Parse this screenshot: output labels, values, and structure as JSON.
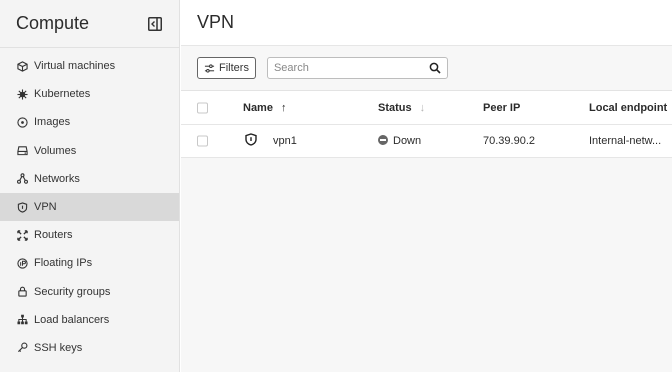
{
  "sidebar": {
    "title": "Compute",
    "collapse_icon": "sidebar-collapse-icon",
    "items": [
      {
        "label": "Virtual machines",
        "icon": "cube-icon",
        "active": false
      },
      {
        "label": "Kubernetes",
        "icon": "helm-icon",
        "active": false
      },
      {
        "label": "Images",
        "icon": "disc-icon",
        "active": false
      },
      {
        "label": "Volumes",
        "icon": "drive-icon",
        "active": false
      },
      {
        "label": "Networks",
        "icon": "network-icon",
        "active": false
      },
      {
        "label": "VPN",
        "icon": "shield-icon",
        "active": true
      },
      {
        "label": "Routers",
        "icon": "router-icon",
        "active": false
      },
      {
        "label": "Floating IPs",
        "icon": "floating-ip-icon",
        "active": false
      },
      {
        "label": "Security groups",
        "icon": "lock-icon",
        "active": false
      },
      {
        "label": "Load balancers",
        "icon": "load-balancer-icon",
        "active": false
      },
      {
        "label": "SSH keys",
        "icon": "key-icon",
        "active": false
      }
    ]
  },
  "header": {
    "title": "VPN"
  },
  "toolbar": {
    "filters_label": "Filters",
    "search_placeholder": "Search",
    "search_value": ""
  },
  "table": {
    "columns": [
      {
        "label": "Name",
        "sort": "asc-active"
      },
      {
        "label": "Status",
        "sort": "inactive"
      },
      {
        "label": "Peer IP"
      },
      {
        "label": "Local endpoint"
      }
    ],
    "rows": [
      {
        "name": "vpn1",
        "status": "Down",
        "peer_ip": "70.39.90.2",
        "local_endpoint": "Internal-netw..."
      }
    ]
  },
  "colors": {
    "sidebar_bg": "#f4f4f4",
    "active_item_bg": "#d9d9d9",
    "main_bg": "#f7f7f7",
    "status_down": "#666666"
  }
}
